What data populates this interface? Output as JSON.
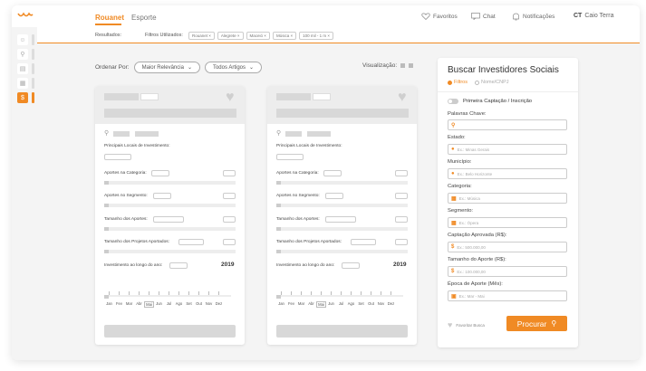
{
  "header": {
    "tabs": [
      {
        "label": "Rouanet"
      },
      {
        "label": "Esporte"
      }
    ],
    "nav": {
      "favoritos": "Favoritos",
      "chat": "Chat",
      "notificacoes": "Notificações",
      "initials": "CT",
      "username": "Caio Terra"
    }
  },
  "filterbar": {
    "resultados_label": "Resultados:",
    "filtros_label": "Filtros Utilizados:",
    "chips": [
      "Rouanet ×",
      "Alegrete ×",
      "Maceió ×",
      "Música ×",
      "100 mil - 1 m ×"
    ]
  },
  "toolbar": {
    "ordenar_label": "Ordenar Por:",
    "sort_value": "Maior Relevância",
    "filter_value": "Todos Artigos",
    "visualizacao_label": "Visualização:"
  },
  "card": {
    "locais_label": "Principais Locais de Investimento:",
    "aportes_categoria": "Aportes na Categoria:",
    "aportes_segmento": "Aportes no Segmento:",
    "tamanho_aportes": "Tamanho dos Aportes:",
    "tamanho_projetos": "Tamanho dos Projetos Aportados:",
    "investimento_ano": "Investimento ao longo do ano:",
    "year": "2019",
    "months": [
      "Jan",
      "Fev",
      "Mar",
      "Abr",
      "Mai",
      "Jun",
      "Jul",
      "Ago",
      "Set",
      "Out",
      "Nov",
      "Dez"
    ]
  },
  "panel": {
    "title": "Buscar Investidores Sociais",
    "radio_filtros": "Filtros",
    "radio_nome": "Nome/CNPJ",
    "toggle_label": "Primeira Captação / Inscrição",
    "palavras_label": "Palavras Chave:",
    "estado_label": "Estado:",
    "estado_placeholder": "Ex.: Minas Gerais",
    "municipio_label": "Município:",
    "municipio_placeholder": "Ex.: Belo Horizonte",
    "categoria_label": "Categoria:",
    "categoria_placeholder": "Ex.: Música",
    "segmento_label": "Segmento:",
    "segmento_placeholder": "Ex.: Ópera",
    "captacao_label": "Captação Aprovada (R$):",
    "captacao_placeholder": "Ex.: 500.000,00",
    "tamanho_label": "Tamanho do Aporte (R$):",
    "tamanho_placeholder": "Ex.: 100.000,00",
    "epoca_label": "Época de Aporte (Mês):",
    "epoca_placeholder": "Ex.: Mar - Mai",
    "favoritar_label": "Favoritar Busca",
    "procurar_label": "Procurar"
  },
  "colors": {
    "accent": "#f08a24"
  }
}
